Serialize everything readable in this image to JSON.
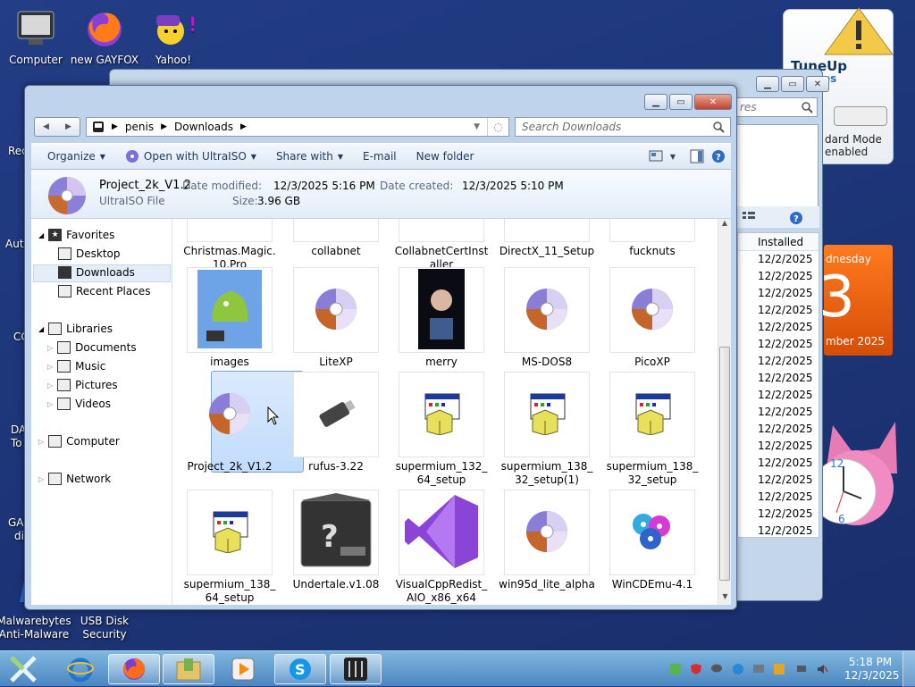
{
  "desktop": {
    "icons": [
      {
        "label": "Computer"
      },
      {
        "label": "new GAYFOX"
      },
      {
        "label": "Yahoo!"
      },
      {
        "label": "Malwarebytes Anti-Malware"
      },
      {
        "label": "USB Disk Security"
      }
    ],
    "clipped_labels": [
      "Rec",
      "Aut",
      "CC",
      "DA",
      "To",
      "GA",
      "di"
    ]
  },
  "bg_window": {
    "search_placeholder": "res",
    "mode_label_1": "dard Mode",
    "mode_label_2": "enabled",
    "column_header": "Installed",
    "dates": [
      "12/2/2025",
      "12/2/2025",
      "12/2/2025",
      "12/2/2025",
      "12/2/2025",
      "12/2/2025",
      "12/2/2025",
      "12/2/2025",
      "12/2/2025",
      "12/2/2025",
      "12/2/2025",
      "12/2/2025",
      "12/2/2025",
      "12/2/2025",
      "12/2/2025",
      "12/2/2025",
      "12/2/2025"
    ]
  },
  "gadgets": {
    "tuneup_title": "TuneUp",
    "tuneup_sub": "es",
    "calendar_day_name": "dnesday",
    "calendar_day": "3",
    "calendar_month": "mber 2025",
    "clock_numbers": [
      "12",
      "6"
    ]
  },
  "explorer": {
    "breadcrumb": [
      "penis",
      "Downloads"
    ],
    "search_placeholder": "Search Downloads",
    "toolbar": {
      "organize": "Organize",
      "open_with": "Open with UltraISO",
      "share_with": "Share with",
      "email": "E-mail",
      "new_folder": "New folder"
    },
    "details": {
      "name": "Project_2k_V1.2",
      "type": "UltraISO File",
      "modified_label": "Date modified:",
      "modified_value": "12/3/2025 5:16 PM",
      "size_label": "Size:",
      "size_value": "3.96 GB",
      "created_label": "Date created:",
      "created_value": "12/3/2025 5:10 PM"
    },
    "nav": {
      "favorites": "Favorites",
      "desktop": "Desktop",
      "downloads": "Downloads",
      "recent": "Recent Places",
      "libraries": "Libraries",
      "documents": "Documents",
      "music": "Music",
      "pictures": "Pictures",
      "videos": "Videos",
      "computer": "Computer",
      "network": "Network"
    },
    "files": [
      {
        "label": "Christmas.Magic.\n10.Pro",
        "icon": "app-icon"
      },
      {
        "label": "collabnet",
        "icon": "file-icon"
      },
      {
        "label": "CollabnetCertInst\naller",
        "icon": "file-icon"
      },
      {
        "label": "DirectX_11_Setup",
        "icon": "app-icon"
      },
      {
        "label": "fucknuts",
        "icon": "image-icon"
      },
      {
        "label": "images",
        "icon": "android-image-icon"
      },
      {
        "label": "LiteXP",
        "icon": "disc-icon"
      },
      {
        "label": "merry",
        "icon": "photo-icon"
      },
      {
        "label": "MS-DOS8",
        "icon": "disc-icon"
      },
      {
        "label": "PicoXP",
        "icon": "disc-icon"
      },
      {
        "label": "Project_2k_V1.2",
        "icon": "disc-icon"
      },
      {
        "label": "rufus-3.22",
        "icon": "usb-drive-icon"
      },
      {
        "label": "supermium_132_\n64_setup",
        "icon": "installer-icon"
      },
      {
        "label": "supermium_138_\n32_setup(1)",
        "icon": "installer-icon"
      },
      {
        "label": "supermium_138_\n32_setup",
        "icon": "installer-icon"
      },
      {
        "label": "supermium_138_\n64_setup",
        "icon": "installer-icon"
      },
      {
        "label": "Undertale.v1.08",
        "icon": "archive-icon"
      },
      {
        "label": "VisualCppRedist_\nAIO_x86_x64",
        "icon": "visual-studio-icon"
      },
      {
        "label": "win95d_lite_alpha",
        "icon": "disc-icon"
      },
      {
        "label": "WinCDEmu-4.1",
        "icon": "wincdemu-icon"
      }
    ]
  },
  "taskbar": {
    "time": "5:18 PM",
    "date": "12/3/2025"
  }
}
